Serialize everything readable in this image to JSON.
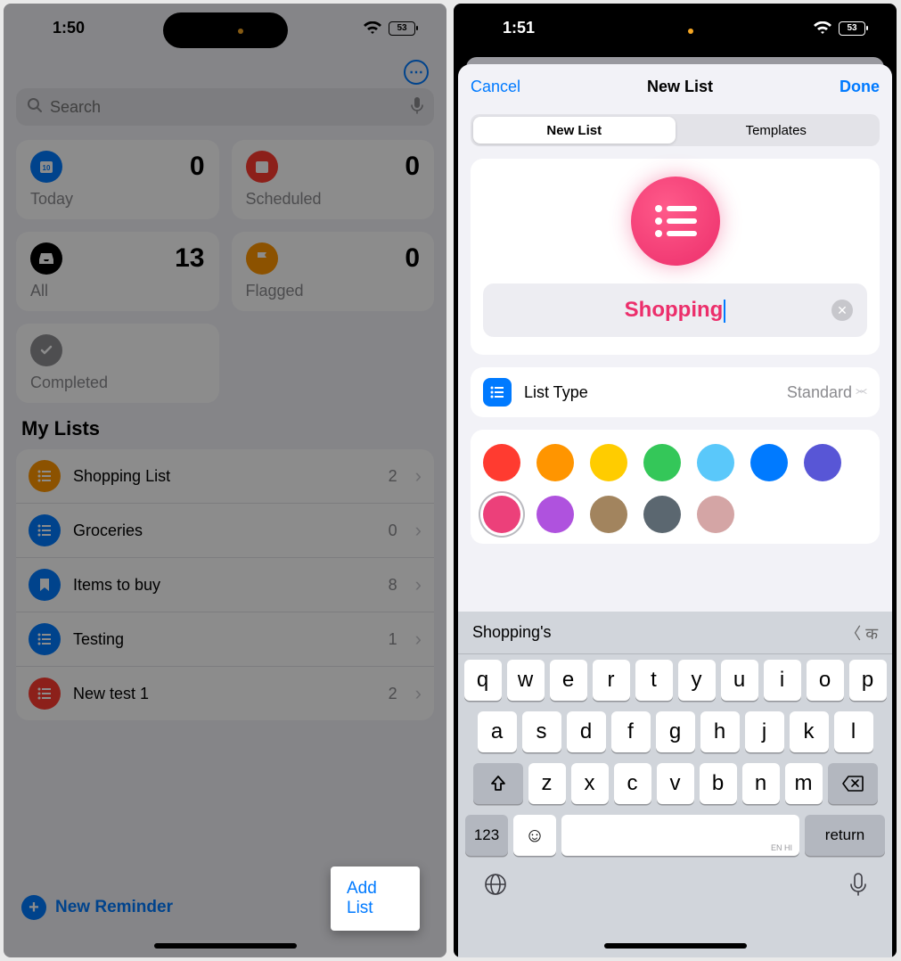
{
  "left": {
    "status": {
      "time": "1:50",
      "battery": "53"
    },
    "search_placeholder": "Search",
    "cards": {
      "today": {
        "label": "Today",
        "count": "0",
        "color": "#007aff"
      },
      "scheduled": {
        "label": "Scheduled",
        "count": "0",
        "color": "#ff3b30"
      },
      "all": {
        "label": "All",
        "count": "13",
        "color": "#000000"
      },
      "flagged": {
        "label": "Flagged",
        "count": "0",
        "color": "#ff9500"
      },
      "completed": {
        "label": "Completed",
        "color": "#8e8e93"
      }
    },
    "section_title": "My Lists",
    "lists": [
      {
        "name": "Shopping List",
        "count": "2",
        "color": "#ff9500",
        "icon": "list"
      },
      {
        "name": "Groceries",
        "count": "0",
        "color": "#007aff",
        "icon": "list"
      },
      {
        "name": "Items to buy",
        "count": "8",
        "color": "#007aff",
        "icon": "bookmark"
      },
      {
        "name": "Testing",
        "count": "1",
        "color": "#007aff",
        "icon": "list"
      },
      {
        "name": "New test 1",
        "count": "2",
        "color": "#ff3b30",
        "icon": "list"
      }
    ],
    "new_reminder": "New Reminder",
    "add_list": "Add List"
  },
  "right": {
    "status": {
      "time": "1:51",
      "battery": "53"
    },
    "nav": {
      "cancel": "Cancel",
      "title": "New List",
      "done": "Done"
    },
    "segments": {
      "new_list": "New List",
      "templates": "Templates"
    },
    "list_name": "Shopping",
    "list_type": {
      "label": "List Type",
      "value": "Standard"
    },
    "colors_row1": [
      "#ff3b30",
      "#ff9500",
      "#ffcc00",
      "#34c759",
      "#5ac8fa",
      "#007aff",
      "#5856d6"
    ],
    "colors_row2": [
      "#ec407a",
      "#af52de",
      "#a2845e",
      "#5b6770",
      "#d4a5a5"
    ],
    "selected_color_index": 0,
    "keyboard": {
      "suggestion": "Shopping's",
      "lang_hint": "〈 क",
      "row1": [
        "q",
        "w",
        "e",
        "r",
        "t",
        "y",
        "u",
        "i",
        "o",
        "p"
      ],
      "row2": [
        "a",
        "s",
        "d",
        "f",
        "g",
        "h",
        "j",
        "k",
        "l"
      ],
      "row3": [
        "z",
        "x",
        "c",
        "v",
        "b",
        "n",
        "m"
      ],
      "num_key": "123",
      "return_key": "return",
      "space_hint": "EN HI"
    }
  }
}
